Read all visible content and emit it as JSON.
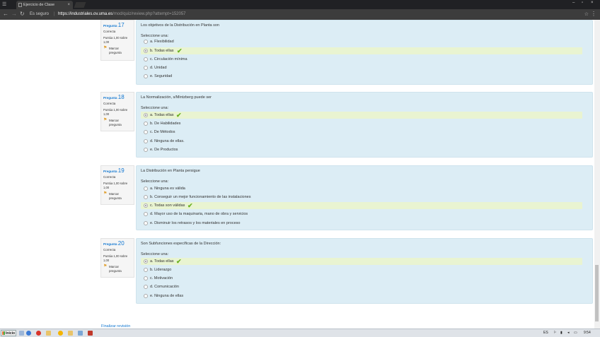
{
  "browser": {
    "tab_title": "Ejercicio de Clase",
    "tab_close": "×",
    "window_controls": [
      "–",
      "▫",
      "×"
    ],
    "secure_label": "Es seguro",
    "url_host": "https://industriales.ov.uma.es",
    "url_path": "/mod/quiz/review.php?attempt=152057"
  },
  "questions": [
    {
      "label": "Pregunta",
      "number": "17",
      "state": "Correcta",
      "grade": "Puntúa 1,00 sobre 1,00",
      "flag": "Marcar pregunta",
      "text": "Los objetivos de la Distribución en Planta son",
      "prompt": "Seleccione una:",
      "options": [
        {
          "label": "a. Flexibilidad",
          "selected": false,
          "correct": false
        },
        {
          "label": "b. Todas ellas",
          "selected": true,
          "correct": true
        },
        {
          "label": "c. Circulación mínima",
          "selected": false,
          "correct": false
        },
        {
          "label": "d. Unidad",
          "selected": false,
          "correct": false
        },
        {
          "label": "e. Seguridad",
          "selected": false,
          "correct": false
        }
      ]
    },
    {
      "label": "Pregunta",
      "number": "18",
      "state": "Correcta",
      "grade": "Puntúa 1,00 sobre 1,00",
      "flag": "Marcar pregunta",
      "text": "La Normalización, s/Mintzberg puede ser",
      "prompt": "Seleccione una:",
      "options": [
        {
          "label": "a. Todas ellas",
          "selected": true,
          "correct": true
        },
        {
          "label": "b. De Habilidades",
          "selected": false,
          "correct": false
        },
        {
          "label": "c. De Métodos",
          "selected": false,
          "correct": false
        },
        {
          "label": "d. Ninguna de ellas.",
          "selected": false,
          "correct": false
        },
        {
          "label": "e. De Productos",
          "selected": false,
          "correct": false
        }
      ]
    },
    {
      "label": "Pregunta",
      "number": "19",
      "state": "Correcta",
      "grade": "Puntúa 1,00 sobre 1,00",
      "flag": "Marcar pregunta",
      "text": "La Distribución en Planta persigue",
      "prompt": "Seleccione una:",
      "options": [
        {
          "label": "a. Ninguna es válida",
          "selected": false,
          "correct": false
        },
        {
          "label": "b. Conseguir un mejor funcionamiento de las instalaciones",
          "selected": false,
          "correct": false
        },
        {
          "label": "c. Todas son válidas",
          "selected": true,
          "correct": true
        },
        {
          "label": "d. Mayor uso de la maquinaria, mano de obra y servicios",
          "selected": false,
          "correct": false
        },
        {
          "label": "e. Disminuir los retrasos y los materiales en proceso",
          "selected": false,
          "correct": false
        }
      ]
    },
    {
      "label": "Pregunta",
      "number": "20",
      "state": "Correcta",
      "grade": "Puntúa 1,00 sobre 1,00",
      "flag": "Marcar pregunta",
      "text": "Son Subfunciones específicas de la Dirección:",
      "prompt": "Seleccione una:",
      "options": [
        {
          "label": "a. Todas ellas",
          "selected": true,
          "correct": true
        },
        {
          "label": "b. Liderazgo",
          "selected": false,
          "correct": false
        },
        {
          "label": "c. Motivación",
          "selected": false,
          "correct": false
        },
        {
          "label": "d. Comunicación",
          "selected": false,
          "correct": false
        },
        {
          "label": "e. Ninguna de ellas",
          "selected": false,
          "correct": false
        }
      ]
    }
  ],
  "finish_link": "Finalizar revisión",
  "taskbar": {
    "start_label": "Inicio",
    "language": "ES",
    "clock": "9:54"
  },
  "colors": {
    "question_bg": "#dcedf5",
    "correct_bg": "#e9f4d1",
    "check": "#6bb120",
    "link": "#1177d1"
  }
}
